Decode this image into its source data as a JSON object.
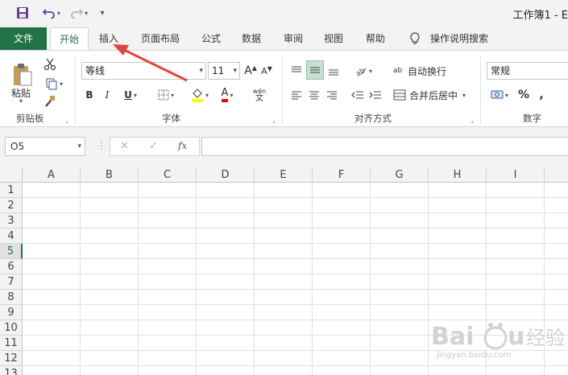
{
  "window": {
    "title": "工作簿1 - E"
  },
  "tabs": {
    "file": "文件",
    "home": "开始",
    "insert": "插入",
    "page_layout": "页面布局",
    "formulas": "公式",
    "data": "数据",
    "review": "审阅",
    "view": "视图",
    "help": "帮助",
    "tell_me": "操作说明搜索"
  },
  "clipboard": {
    "paste": "粘贴",
    "label": "剪贴板"
  },
  "font": {
    "name": "等线",
    "size": "11",
    "bold": "B",
    "italic": "I",
    "underline": "U",
    "label": "字体",
    "grow": "A",
    "shrink": "A",
    "color_letter": "A",
    "phonetic_top": "wén",
    "phonetic_bottom": "文",
    "highlight_color": "#ffff00",
    "font_color": "#ff0000"
  },
  "alignment": {
    "wrap_text": "自动换行",
    "merge_center": "合并后居中",
    "label": "对齐方式",
    "wrap_glyph": "ab"
  },
  "number": {
    "format": "常规",
    "percent": "%",
    "comma": ",",
    "label": "数字"
  },
  "formula_bar": {
    "name_box": "O5",
    "cancel": "✕",
    "enter": "✓",
    "fx": "fx",
    "value": ""
  },
  "sheet": {
    "columns": [
      "A",
      "B",
      "C",
      "D",
      "E",
      "F",
      "G",
      "H",
      "I"
    ],
    "rows": [
      "1",
      "2",
      "3",
      "4",
      "5",
      "6",
      "7",
      "8",
      "9",
      "10",
      "11",
      "12",
      "13"
    ],
    "active_row": "5"
  },
  "watermark": {
    "url_text": "jingyan.baidu.com",
    "brand": "Baidu 经验"
  },
  "colors": {
    "accent": "#217346",
    "arrow": "#e0463c"
  }
}
